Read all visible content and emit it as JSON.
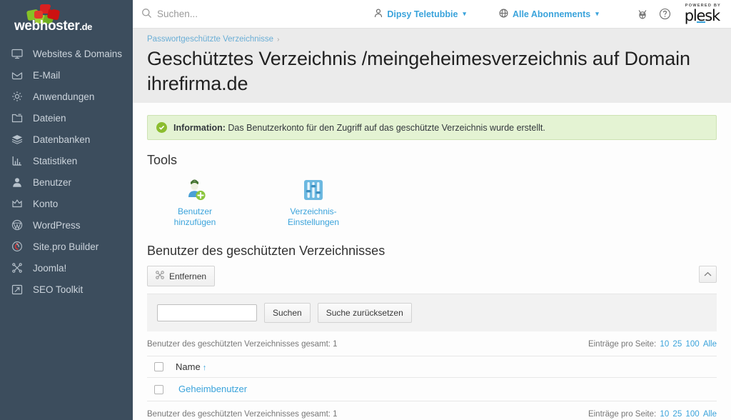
{
  "sidebar": {
    "brand_name": "webhoster",
    "brand_tld": ".de",
    "items": [
      {
        "label": "Websites & Domains",
        "icon": "monitor-icon"
      },
      {
        "label": "E-Mail",
        "icon": "envelope-icon"
      },
      {
        "label": "Anwendungen",
        "icon": "gear-icon"
      },
      {
        "label": "Dateien",
        "icon": "folder-icon"
      },
      {
        "label": "Datenbanken",
        "icon": "database-icon"
      },
      {
        "label": "Statistiken",
        "icon": "bar-chart-icon"
      },
      {
        "label": "Benutzer",
        "icon": "person-icon"
      },
      {
        "label": "Konto",
        "icon": "crown-icon"
      },
      {
        "label": "WordPress",
        "icon": "wordpress-icon"
      },
      {
        "label": "Site.pro Builder",
        "icon": "sitepro-icon"
      },
      {
        "label": "Joomla!",
        "icon": "joomla-icon"
      },
      {
        "label": "SEO Toolkit",
        "icon": "seo-arrow-icon"
      }
    ]
  },
  "topbar": {
    "search_placeholder": "Suchen...",
    "user_name": "Dipsy Teletubbie",
    "subscription": "Alle Abonnements",
    "bug_icon": "bug-icon",
    "help_icon": "help-circle-icon",
    "logo_powered": "POWERED BY",
    "logo_name": "plesk"
  },
  "page": {
    "breadcrumb": "Passwortgeschützte Verzeichnisse",
    "breadcrumb_separator": "›",
    "title": "Geschütztes Verzeichnis /meingeheimesverzeichnis auf Domain ihrefirma.de"
  },
  "banner": {
    "icon": "check-circle-icon",
    "label": "Information:",
    "message": "Das Benutzerkonto für den Zugriff auf das geschützte Verzeichnis wurde erstellt."
  },
  "tools": {
    "heading": "Tools",
    "items": [
      {
        "label": "Benutzer hinzufügen",
        "icon": "user-add-icon"
      },
      {
        "label": "Verzeichnis-Einstellungen",
        "icon": "sliders-icon"
      }
    ]
  },
  "list": {
    "heading": "Benutzer des geschützten Verzeichnisses",
    "remove_button": "Entfernen",
    "remove_icon": "scissors-icon",
    "collapse_icon": "chevron-up-icon",
    "search_value": "",
    "search_button": "Suchen",
    "reset_button": "Suche zurücksetzen",
    "total_text_top": "Benutzer des geschützten Verzeichnisses gesamt: 1",
    "total_text_bottom": "Benutzer des geschützten Verzeichnisses gesamt: 1",
    "per_page_label": "Einträge pro Seite:",
    "per_page_options": [
      "10",
      "25",
      "100",
      "Alle"
    ],
    "columns": [
      "Name"
    ],
    "sort_indicator": "↑",
    "rows": [
      {
        "name": "Geheimbenutzer"
      }
    ]
  },
  "colors": {
    "sidebar_bg": "#3c4d5d",
    "accent": "#3aa3db",
    "banner_bg": "#e4f3d3",
    "banner_border": "#cde3b3",
    "success": "#8bbd2e",
    "header_bg": "#ebebeb"
  }
}
